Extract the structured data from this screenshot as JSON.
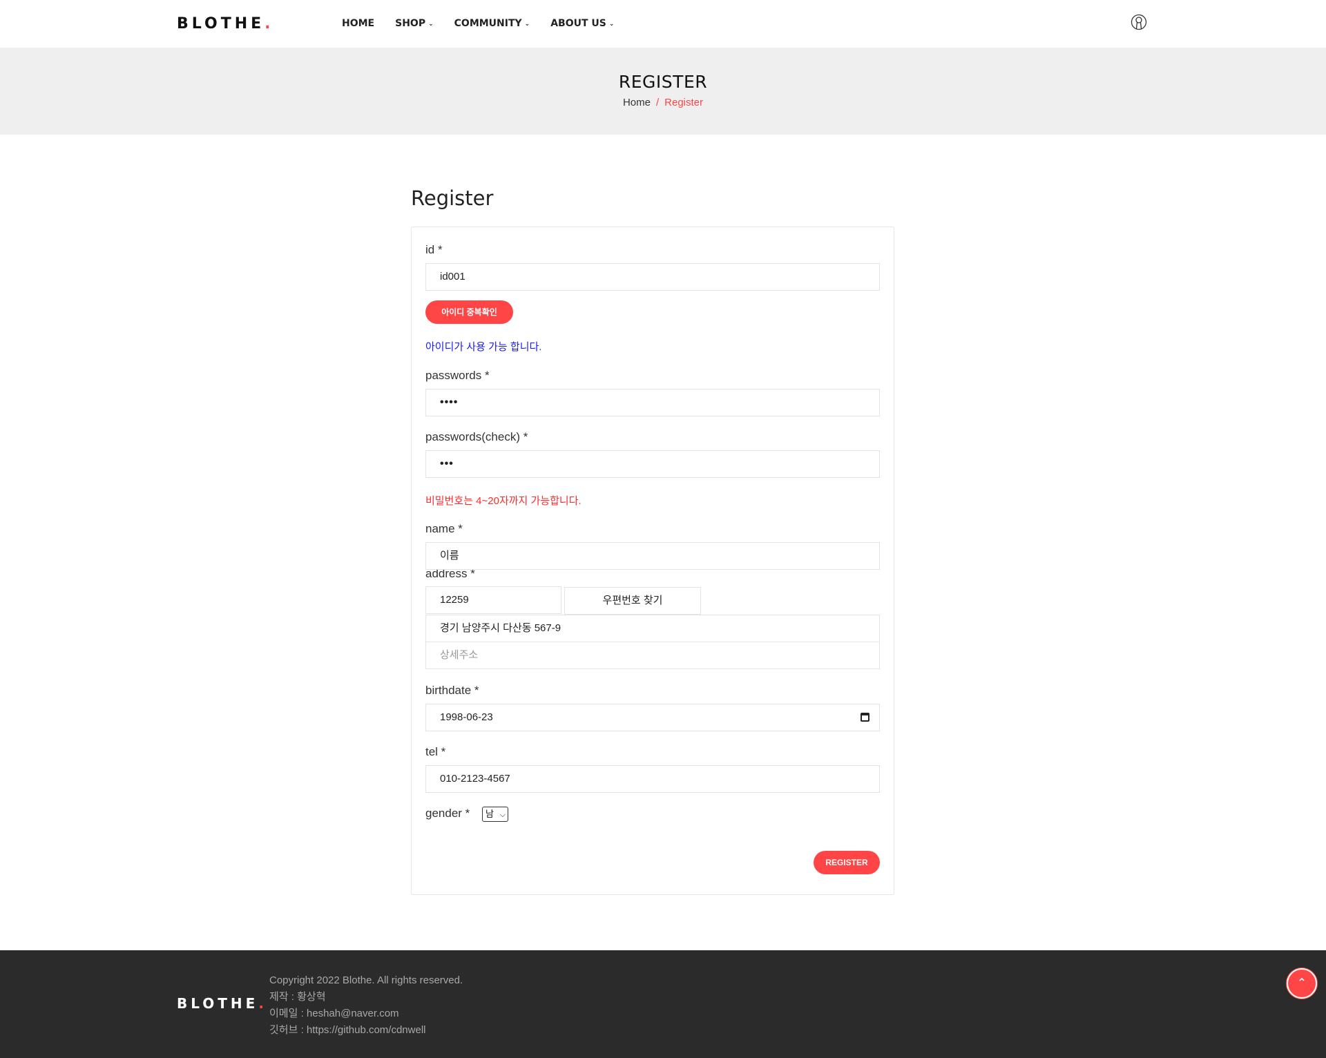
{
  "header": {
    "logo": "BLOTHE",
    "logo_dot": ".",
    "nav": [
      "HOME",
      "SHOP",
      "COMMUNITY",
      "ABOUT US"
    ],
    "user_icon": "user-icon"
  },
  "banner": {
    "title": "REGISTER",
    "breadcrumb_home": "Home",
    "breadcrumb_sep": "/",
    "breadcrumb_current": "Register"
  },
  "form": {
    "title": "Register",
    "id_label": "id *",
    "id_value": "id001",
    "id_check_button": "아이디 중복확인",
    "id_message": "아이디가 사용 가능 합니다.",
    "password_label": "passwords *",
    "password_value": "••••",
    "password_check_label": "passwords(check) *",
    "password_check_value": "•••",
    "password_message": "비밀번호는 4~20자까지 가능합니다.",
    "name_label": "name *",
    "name_value": "이름",
    "address_label": "address *",
    "postcode_value": "12259",
    "postcode_button": "우편번호 찾기",
    "address_value": "경기 남양주시 다산동 567-9",
    "address_detail_placeholder": "상세주소",
    "birthdate_label": "birthdate *",
    "birthdate_value": "1998-06-23",
    "tel_label": "tel *",
    "tel_value": "010-2123-4567",
    "gender_label": "gender *",
    "gender_value": "남",
    "submit_button": "REGISTER"
  },
  "footer": {
    "logo": "BLOTHE",
    "logo_dot": ".",
    "copyright": "Copyright 2022 Blothe. All rights reserved.",
    "maker": "제작 : 황상혁",
    "email": "이메일 : heshah@naver.com",
    "github": "깃허브 : https://github.com/cdnwell"
  },
  "colors": {
    "accent": "#ff4545",
    "ok_message": "#1a1aff",
    "banner_bg": "#efefef",
    "footer_bg": "#2b2b2b"
  }
}
